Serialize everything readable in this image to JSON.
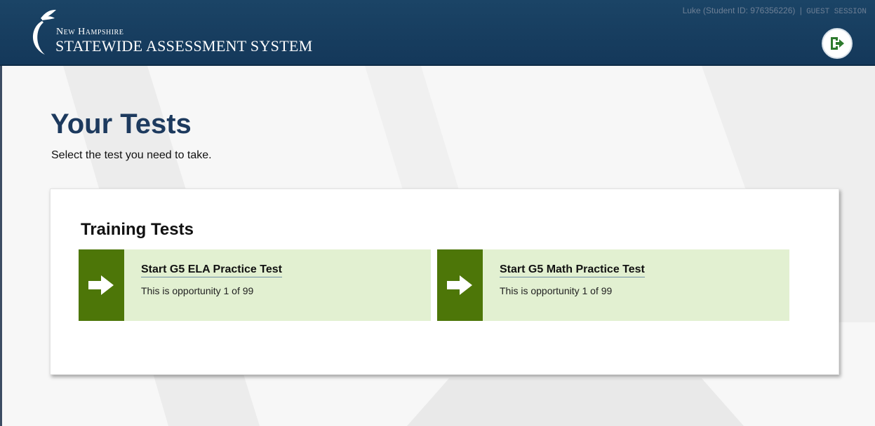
{
  "header": {
    "brand_top": "New Hampshire",
    "brand_bottom": "STATEWIDE ASSESSMENT SYSTEM",
    "user_text": "Luke (Student ID: 976356226)",
    "separator": "|",
    "session_text": "GUEST SESSION",
    "logout_icon": "logout-icon"
  },
  "main": {
    "title": "Your Tests",
    "subtitle": "Select the test you need to take."
  },
  "section": {
    "title": "Training Tests",
    "tests": [
      {
        "title": "Start G5 ELA Practice Test",
        "subtitle": "This is opportunity 1 of 99",
        "icon": "arrow-right-icon"
      },
      {
        "title": "Start G5 Math Practice Test",
        "subtitle": "This is opportunity 1 of 99",
        "icon": "arrow-right-icon"
      }
    ]
  },
  "colors": {
    "header_bg": "#1b4466",
    "title": "#1d3a5e",
    "card_bg": "#e2f0d1",
    "card_accent": "#4d7608",
    "logout_accent": "#2d7a2d"
  }
}
